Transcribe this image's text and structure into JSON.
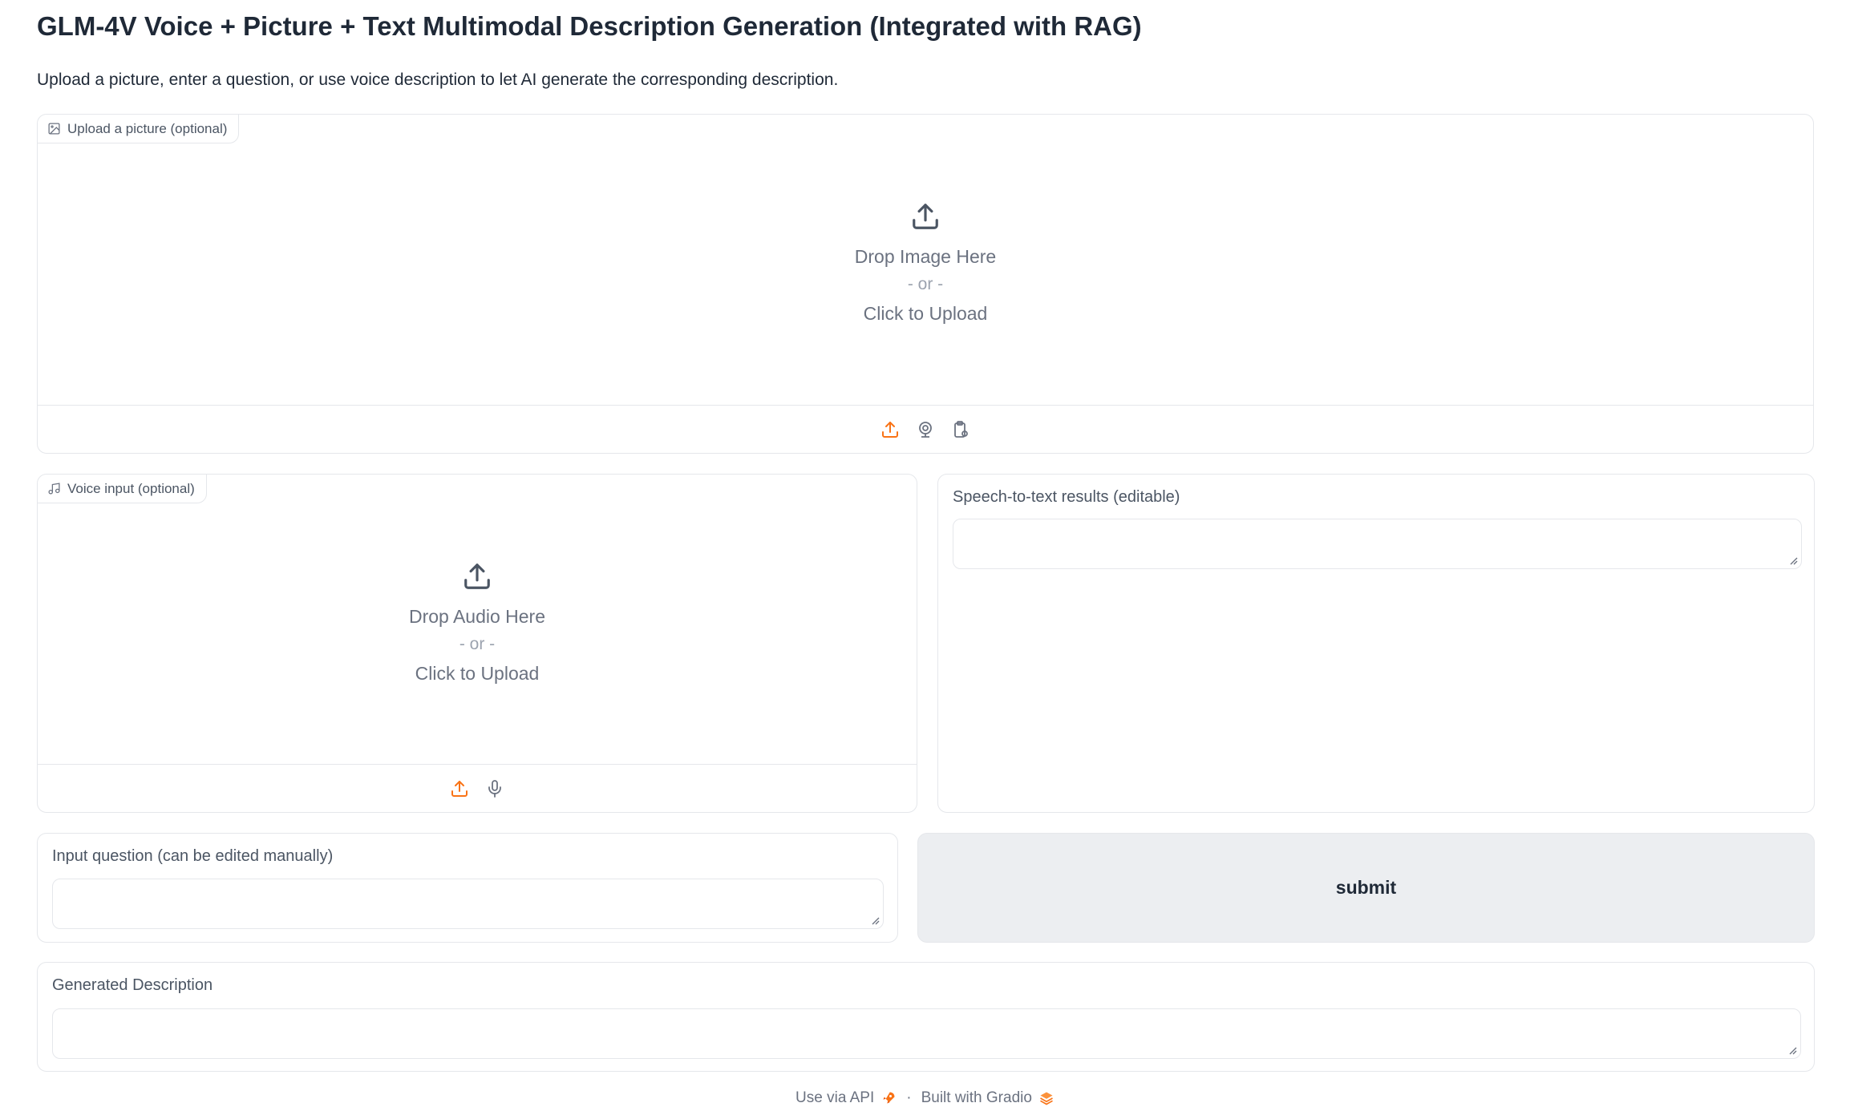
{
  "header": {
    "title": "GLM-4V Voice + Picture + Text Multimodal Description Generation (Integrated with RAG)",
    "subtitle": "Upload a picture, enter a question, or use voice description to let AI generate the corresponding description."
  },
  "image_upload": {
    "label": "Upload a picture (optional)",
    "drop_text": "Drop Image Here",
    "or_text": "- or -",
    "click_text": "Click to Upload",
    "sources": [
      "upload-icon",
      "webcam-icon",
      "clipboard-icon"
    ]
  },
  "audio_upload": {
    "label": "Voice input (optional)",
    "drop_text": "Drop Audio Here",
    "or_text": "- or -",
    "click_text": "Click to Upload",
    "sources": [
      "upload-icon",
      "microphone-icon"
    ]
  },
  "speech_result": {
    "label": "Speech-to-text results (editable)",
    "value": ""
  },
  "question": {
    "label": "Input question (can be edited manually)",
    "value": ""
  },
  "submit": {
    "label": "submit"
  },
  "output": {
    "label": "Generated Description",
    "value": ""
  },
  "footer": {
    "api_text": "Use via API",
    "separator": "·",
    "built_text": "Built with Gradio"
  },
  "colors": {
    "accent": "#f97316",
    "border": "#e5e7eb",
    "button_bg": "#eceef1",
    "text": "#1f2937",
    "muted": "#6b7280"
  }
}
